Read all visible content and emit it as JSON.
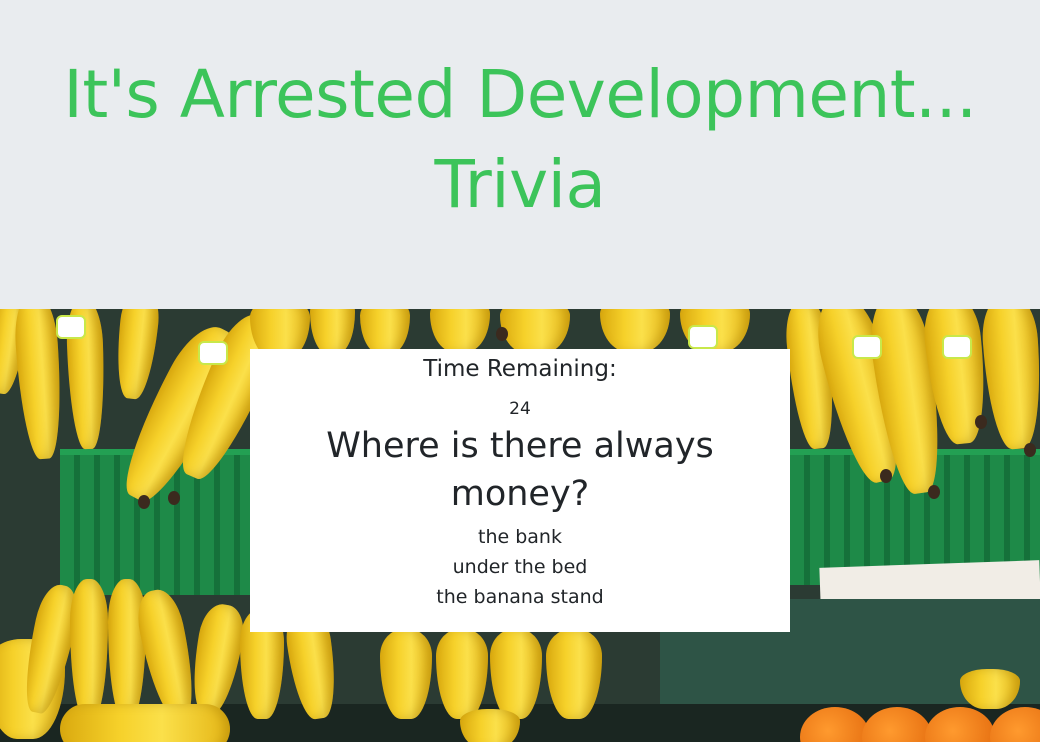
{
  "header": {
    "title": "It's Arrested Development... Trivia"
  },
  "background": {
    "image": "bananas-at-market-photo"
  },
  "trivia": {
    "timer_label": "Time Remaining:",
    "timer_value": "24",
    "question": "Where is there always money?",
    "answers": [
      "the bank",
      "under the bed",
      "the banana stand"
    ]
  },
  "colors": {
    "title": "#3cc45a",
    "header_bg": "#e9ecef",
    "card_bg": "#ffffff",
    "text": "#212529"
  }
}
